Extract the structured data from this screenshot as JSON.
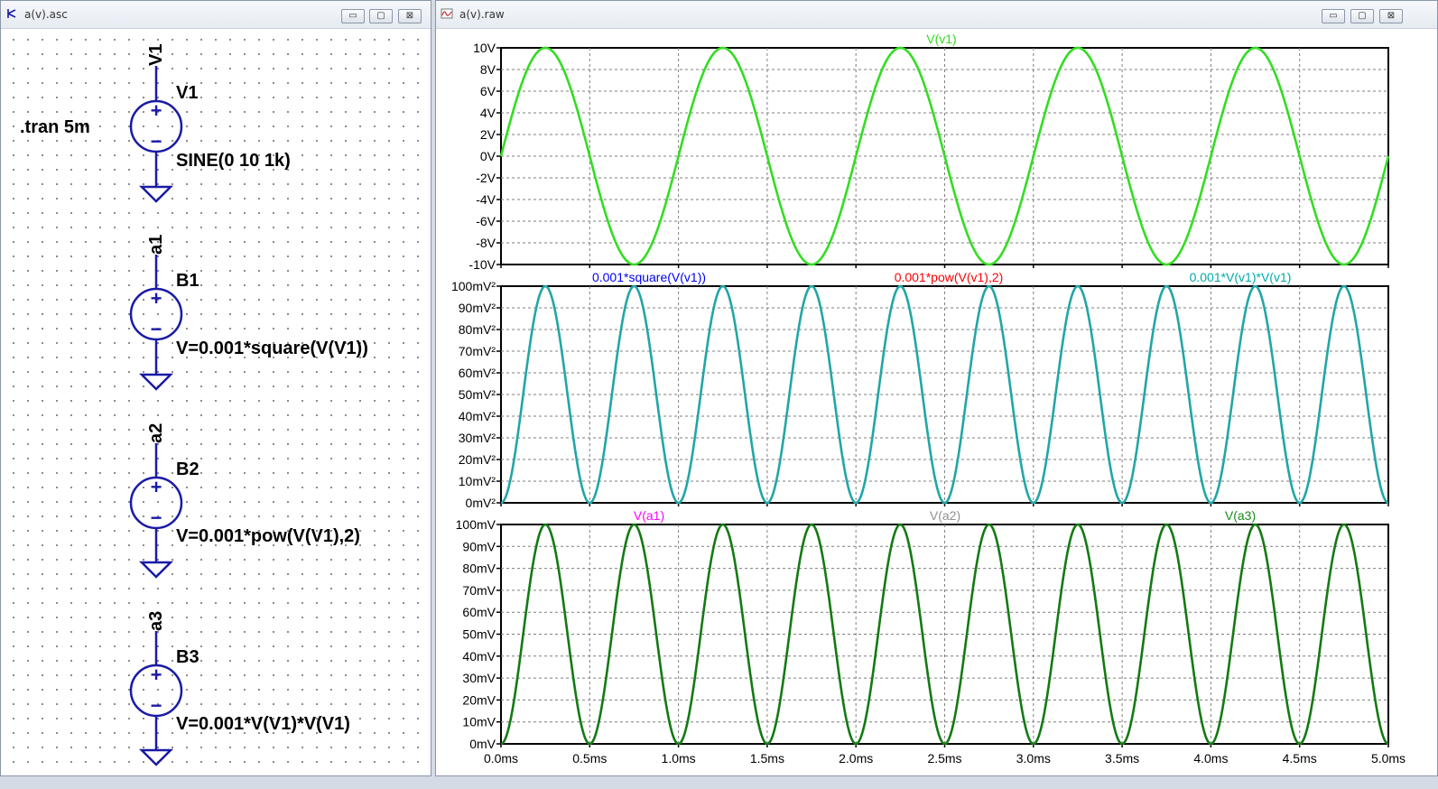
{
  "schematic_window": {
    "title": "a(v).asc",
    "directive": ".tran 5m",
    "sources": [
      {
        "net": "V1",
        "name": "V1",
        "value": "SINE(0 10 1k)"
      },
      {
        "net": "a1",
        "name": "B1",
        "value": "V=0.001*square(V(V1))"
      },
      {
        "net": "a2",
        "name": "B2",
        "value": "V=0.001*pow(V(V1),2)"
      },
      {
        "net": "a3",
        "name": "B3",
        "value": "V=0.001*V(V1)*V(V1)"
      }
    ],
    "plus_sign": "+",
    "minus_sign": "−"
  },
  "waveform_window": {
    "title": "a(v).raw"
  },
  "window_buttons": {
    "minimize": "▭",
    "maximize": "▢",
    "close": "⊠"
  },
  "colors": {
    "wire": "#1a1aa6",
    "grid": "#7f7f7f",
    "v_v1": "#33dd22",
    "square": "#0000ff",
    "pow": "#ff0000",
    "mult": "#00aaaa",
    "trace2": "#22a6a6",
    "v_a1": "#ff00ff",
    "v_a2": "#909090",
    "v_a3": "#1a8a1a",
    "trace3": "#147a14"
  },
  "chart_data": [
    {
      "type": "line",
      "x_range": [
        0,
        5
      ],
      "x_unit": "ms",
      "ylim": [
        -10,
        10
      ],
      "yticks": [
        "10V",
        "8V",
        "6V",
        "4V",
        "2V",
        "0V",
        "-2V",
        "-4V",
        "-6V",
        "-8V",
        "-10V"
      ],
      "series": [
        {
          "name": "V(v1)",
          "expression": "10*sin(2*pi*1*t)",
          "amplitude": 10,
          "frequency_khz": 1
        }
      ]
    },
    {
      "type": "line",
      "x_range": [
        0,
        5
      ],
      "x_unit": "ms",
      "ylim": [
        0,
        100
      ],
      "yticks": [
        "100mV²",
        "90mV²",
        "80mV²",
        "70mV²",
        "60mV²",
        "50mV²",
        "40mV²",
        "30mV²",
        "20mV²",
        "10mV²",
        "0mV²"
      ],
      "series": [
        {
          "name": "0.001*square(V(v1))",
          "expression": "100*sin(2*pi*t)^2"
        },
        {
          "name": "0.001*pow(V(v1),2)",
          "expression": "100*sin(2*pi*t)^2"
        },
        {
          "name": "0.001*V(v1)*V(v1)",
          "expression": "100*sin(2*pi*t)^2"
        }
      ]
    },
    {
      "type": "line",
      "x_range": [
        0,
        5
      ],
      "x_unit": "ms",
      "ylim": [
        0,
        100
      ],
      "yticks": [
        "100mV",
        "90mV",
        "80mV",
        "70mV",
        "60mV",
        "50mV",
        "40mV",
        "30mV",
        "20mV",
        "10mV",
        "0mV"
      ],
      "xticks": [
        "0.0ms",
        "0.5ms",
        "1.0ms",
        "1.5ms",
        "2.0ms",
        "2.5ms",
        "3.0ms",
        "3.5ms",
        "4.0ms",
        "4.5ms",
        "5.0ms"
      ],
      "series": [
        {
          "name": "V(a1)",
          "expression": "100*sin(2*pi*t)^2"
        },
        {
          "name": "V(a2)",
          "expression": "100*sin(2*pi*t)^2"
        },
        {
          "name": "V(a3)",
          "expression": "100*sin(2*pi*t)^2"
        }
      ]
    }
  ]
}
